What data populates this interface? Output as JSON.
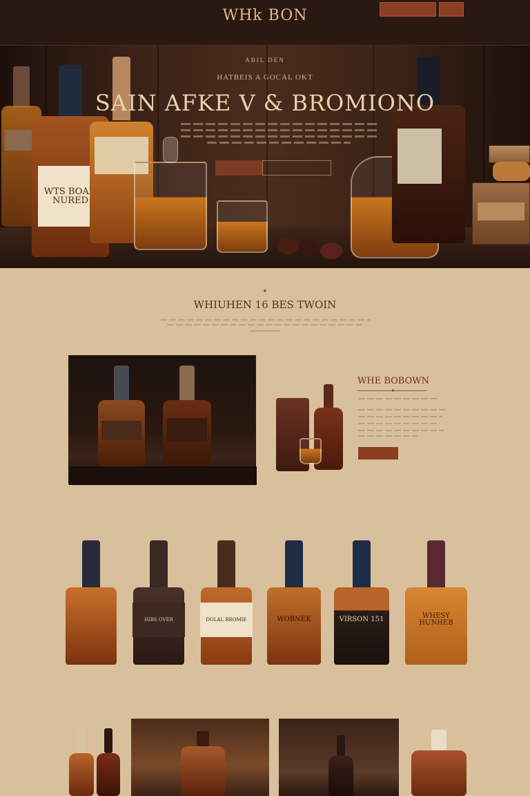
{
  "header": {
    "utility_links": [
      "",
      ""
    ],
    "logo": "WHk BON",
    "logo_sub": "",
    "nav_left": [
      "",
      "",
      "",
      ""
    ],
    "nav_right": [
      "",
      "",
      "",
      "",
      ""
    ],
    "buttons": [
      "",
      ""
    ]
  },
  "hero": {
    "eyebrow": "ABIL DEN",
    "kicker": "HATBEIS A GOCAL OKT",
    "title": "SAIN AFKE V & BROMIONO",
    "cta_primary": "",
    "cta_secondary": "",
    "bottle_label_1": "WTS BOAN NURED",
    "bottle_label_2": "",
    "crate_label": ""
  },
  "intro": {
    "title": "WHIUHEN 16 BES TWOIN",
    "subtitle": ""
  },
  "feature": {
    "title": "WHE BOBOWN",
    "text": "",
    "button": ""
  },
  "products": [
    {
      "label": "",
      "name": "",
      "desc": "",
      "cap": "#2a2b3a",
      "body": "#b3561e"
    },
    {
      "label": "HIBS OVER",
      "name": "",
      "desc": "",
      "cap": "#3a2a24",
      "body": "#3a2620"
    },
    {
      "label": "DOLAL BROMIE",
      "name": "",
      "desc": "",
      "cap": "#4a2c1e",
      "body": "#a9542b"
    },
    {
      "label": "WOBNEK",
      "name": "",
      "desc": "",
      "cap": "#1e2c44",
      "body": "#a85a22"
    },
    {
      "label": "VIRSON 151",
      "name": "",
      "desc": "",
      "cap": "#1e2c48",
      "body": "#2a1d18"
    },
    {
      "label": "WHESY HUNHEB",
      "name": "",
      "desc": "",
      "cap": "#5a2830",
      "body": "#c8782a"
    }
  ],
  "colors": {
    "accent": "#8c3d22",
    "background": "#d9c09c",
    "header": "#2a1812",
    "gold": "#e0b98b"
  }
}
